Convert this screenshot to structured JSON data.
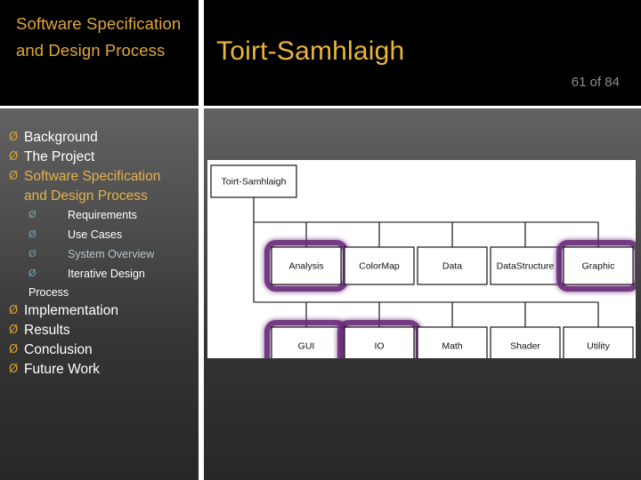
{
  "header": {
    "section_title": "Software Specification and Design Process",
    "deck_title": "Toirt-Samhlaigh",
    "slide_counter": "61 of 84"
  },
  "colors": {
    "accent_gold": "#e6b04a",
    "title_gold": "#e9b53c",
    "bullet_gold": "#d9a235",
    "bullet_teal": "#6fa8b8",
    "header_bg": "#000000",
    "divider": "#ffffff",
    "highlight_purple": "#6b2c7a",
    "counter_gray": "#8d8d8d"
  },
  "outline": {
    "bullet_glyph_level1": "Ø",
    "bullet_glyph_level2": "Ø",
    "items": [
      {
        "label": "Background",
        "level": 1,
        "state": "normal"
      },
      {
        "label": "The Project",
        "level": 1,
        "state": "normal"
      },
      {
        "label": "Software Specification",
        "level": 1,
        "state": "accent",
        "wrap": "and Design Process"
      },
      {
        "label": "Requirements",
        "level": 2,
        "state": "normal"
      },
      {
        "label": "Use Cases",
        "level": 2,
        "state": "normal"
      },
      {
        "label": "System Overview",
        "level": 2,
        "state": "dim"
      },
      {
        "label": "Iterative Design",
        "level": 2,
        "state": "normal",
        "wrap": "Process"
      },
      {
        "label": "Implementation",
        "level": 1,
        "state": "normal"
      },
      {
        "label": "Results",
        "level": 1,
        "state": "normal"
      },
      {
        "label": "Conclusion",
        "level": 1,
        "state": "normal"
      },
      {
        "label": "Future Work",
        "level": 1,
        "state": "normal"
      }
    ]
  },
  "diagram": {
    "type": "package-hierarchy",
    "root": "Toirt-Samhlaigh",
    "row1": [
      {
        "label": "Analysis",
        "highlighted": true
      },
      {
        "label": "ColorMap",
        "highlighted": false
      },
      {
        "label": "Data",
        "highlighted": false
      },
      {
        "label": "DataStructure",
        "highlighted": false
      },
      {
        "label": "Graphic",
        "highlighted": true
      }
    ],
    "row2": [
      {
        "label": "GUI",
        "highlighted": true
      },
      {
        "label": "IO",
        "highlighted": true
      },
      {
        "label": "Math",
        "highlighted": false
      },
      {
        "label": "Shader",
        "highlighted": false
      },
      {
        "label": "Utility",
        "highlighted": false
      }
    ]
  }
}
